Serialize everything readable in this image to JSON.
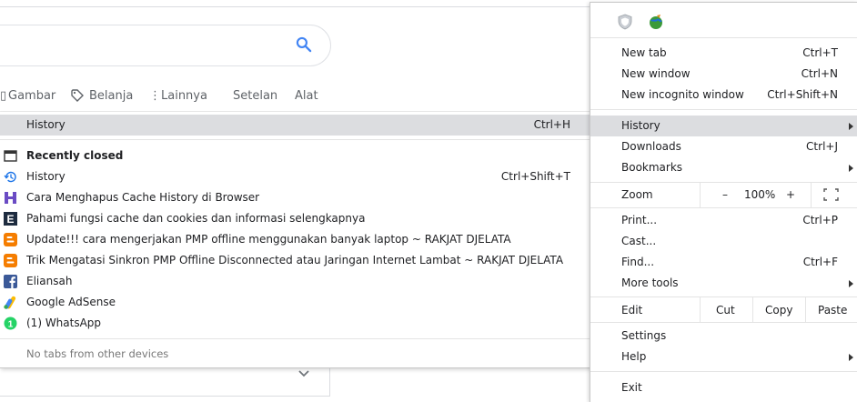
{
  "google": {
    "nav": [
      "Gambar",
      "Belanja",
      "Lainnya",
      "Setelan",
      "Alat"
    ]
  },
  "history_submenu": {
    "header": {
      "label": "History",
      "shortcut": "Ctrl+H"
    },
    "recently_closed_label": "Recently closed",
    "items": [
      {
        "label": "History",
        "shortcut": "Ctrl+Shift+T",
        "icon": "history-icon"
      },
      {
        "label": "Cara Menghapus Cache  History di Browser",
        "shortcut": "",
        "icon": "site-favicon-h-icon"
      },
      {
        "label": "Pahami fungsi cache dan cookies dan informasi selengkapnya",
        "shortcut": "",
        "icon": "site-favicon-e-icon"
      },
      {
        "label": "Update!!! cara mengerjakan PMP offline menggunakan banyak laptop ~ RAKJAT DJELATA",
        "shortcut": "",
        "icon": "blogger-icon"
      },
      {
        "label": "Trik Mengatasi Sinkron PMP Offline Disconnected atau Jaringan Internet Lambat ~ RAKJAT DJELATA",
        "shortcut": "",
        "icon": "blogger-icon"
      },
      {
        "label": "Eliansah",
        "shortcut": "",
        "icon": "facebook-icon"
      },
      {
        "label": "Google AdSense",
        "shortcut": "",
        "icon": "adsense-icon"
      },
      {
        "label": "(1) WhatsApp",
        "shortcut": "",
        "icon": "whatsapp-icon"
      }
    ],
    "no_tabs_label": "No tabs from other devices"
  },
  "chrome_menu": {
    "new_tab": {
      "label": "New tab",
      "shortcut": "Ctrl+T"
    },
    "new_window": {
      "label": "New window",
      "shortcut": "Ctrl+N"
    },
    "new_incognito": {
      "label": "New incognito window",
      "shortcut": "Ctrl+Shift+N"
    },
    "history": {
      "label": "History"
    },
    "downloads": {
      "label": "Downloads",
      "shortcut": "Ctrl+J"
    },
    "bookmarks": {
      "label": "Bookmarks"
    },
    "zoom": {
      "label": "Zoom",
      "minus": "–",
      "value": "100%",
      "plus": "+"
    },
    "print": {
      "label": "Print...",
      "shortcut": "Ctrl+P"
    },
    "cast": {
      "label": "Cast..."
    },
    "find": {
      "label": "Find...",
      "shortcut": "Ctrl+F"
    },
    "more_tools": {
      "label": "More tools"
    },
    "edit": {
      "label": "Edit",
      "cut": "Cut",
      "copy": "Copy",
      "paste": "Paste"
    },
    "settings": {
      "label": "Settings"
    },
    "help": {
      "label": "Help"
    },
    "exit": {
      "label": "Exit"
    }
  },
  "colors": {
    "highlight": "#dcdde0",
    "search_blue": "#4285f4"
  }
}
